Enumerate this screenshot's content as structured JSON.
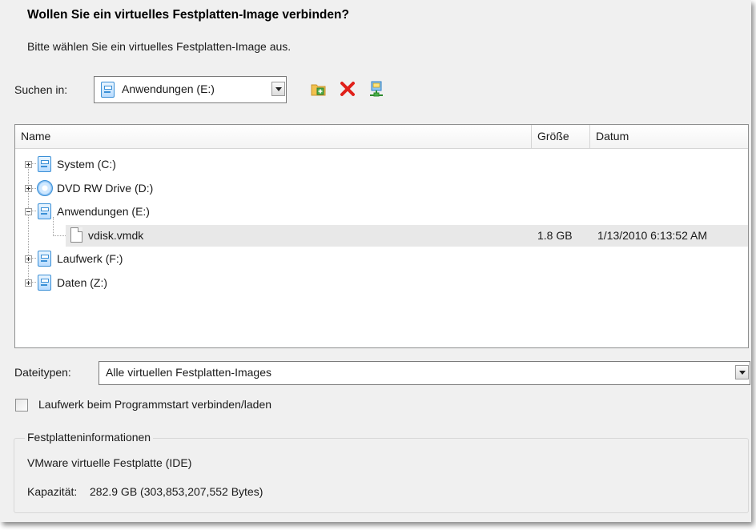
{
  "dialog": {
    "title": "Wollen Sie ein virtuelles Festplatten-Image verbinden?",
    "subtitle": "Bitte wählen Sie ein virtuelles Festplatten-Image aus."
  },
  "lookin": {
    "label": "Suchen in:",
    "value": "Anwendungen (E:)",
    "icon": "drive-icon"
  },
  "toolbar": {
    "new_folder_icon": "new-folder-icon",
    "delete_icon": "delete-icon",
    "network_icon": "network-drive-icon"
  },
  "list": {
    "columns": [
      "Name",
      "Größe",
      "Datum"
    ],
    "items": [
      {
        "label": "System (C:)",
        "icon": "drive-icon",
        "expander": "+",
        "size": "",
        "date": ""
      },
      {
        "label": "DVD RW Drive (D:)",
        "icon": "cd-icon",
        "expander": "+",
        "size": "",
        "date": ""
      },
      {
        "label": "Anwendungen (E:)",
        "icon": "drive-icon",
        "expander": "-",
        "size": "",
        "date": ""
      },
      {
        "label": "vdisk.vmdk",
        "icon": "file-icon",
        "expander": "",
        "size": "1.8 GB",
        "date": "1/13/2010 6:13:52 AM"
      },
      {
        "label": "Laufwerk (F:)",
        "icon": "drive-icon",
        "expander": "+",
        "size": "",
        "date": ""
      },
      {
        "label": "Daten (Z:)",
        "icon": "drive-icon",
        "expander": "+",
        "size": "",
        "date": ""
      }
    ]
  },
  "filetype": {
    "label": "Dateitypen:",
    "value": "Alle virtuellen Festplatten-Images"
  },
  "autoconnect": {
    "label": "Laufwerk beim Programmstart verbinden/laden",
    "checked": false
  },
  "diskinfo": {
    "title": "Festplatteninformationen",
    "type": "VMware virtuelle Festplatte (IDE)",
    "capacity_label": "Kapazität:",
    "capacity_value": "282.9 GB (303,853,207,552 Bytes)"
  },
  "colors": {
    "background": "#f0f0f0",
    "selection": "#e8e8e8",
    "drive_blue": "#3a8fd6",
    "delete_red": "#e0201a"
  }
}
